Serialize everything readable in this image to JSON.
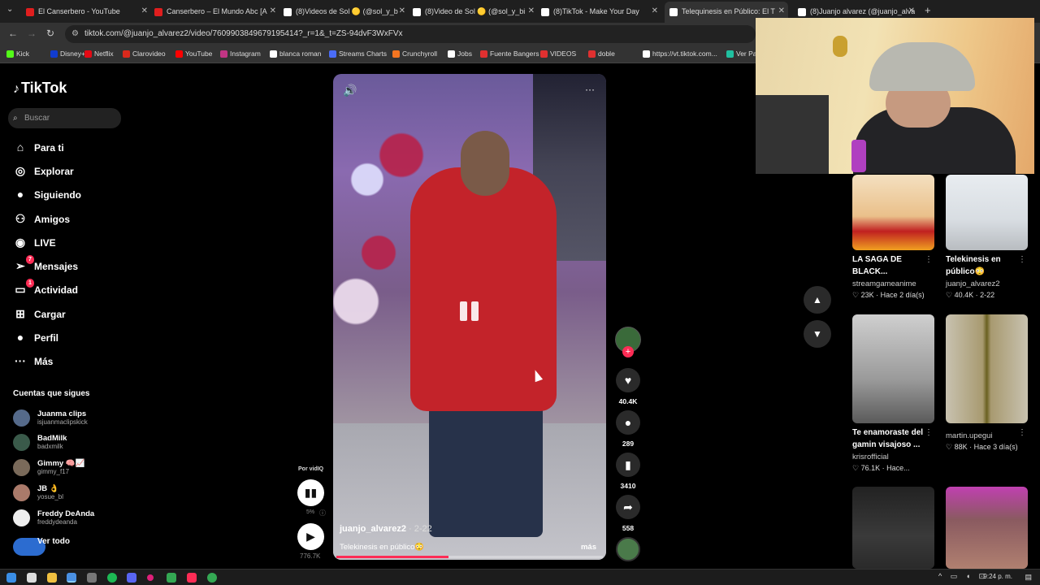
{
  "browser": {
    "tabs": [
      {
        "title": "El Canserbero - YouTube",
        "color": "#e01e1e"
      },
      {
        "title": "Canserbero – El Mundo Abc [A",
        "color": "#e01e1e"
      },
      {
        "title": "(8)Videos de Sol 🟡 (@sol_y_b",
        "color": "#ffffff"
      },
      {
        "title": "(8)Video de Sol 🟡 (@sol_y_bi",
        "color": "#ffffff"
      },
      {
        "title": "(8)TikTok - Make Your Day",
        "color": "#ffffff"
      },
      {
        "title": "Telequinesis en Público: El T",
        "color": "#ffffff"
      },
      {
        "title": "(8)Juanjo alvarez (@juanjo_alva",
        "color": "#ffffff"
      }
    ],
    "new_tab": "+",
    "url": "tiktok.com/@juanjo_alvarez2/video/7609903849679195414?_r=1&_t=ZS-94dvF3WxFVx",
    "bookmarks": [
      {
        "label": "Kick",
        "color": "#53fc18"
      },
      {
        "label": "Disney+",
        "color": "#113ccf"
      },
      {
        "label": "Netflix",
        "color": "#e50914"
      },
      {
        "label": "Clarovideo",
        "color": "#da291c"
      },
      {
        "label": "YouTube",
        "color": "#ff0000"
      },
      {
        "label": "Instagram",
        "color": "#c13584"
      },
      {
        "label": "blanca roman",
        "color": "#ffffff"
      },
      {
        "label": "Streams Charts",
        "color": "#4a6cf7"
      },
      {
        "label": "Crunchyroll",
        "color": "#f47521"
      },
      {
        "label": "Jobs",
        "color": "#ffffff"
      },
      {
        "label": "Fuente Bangers",
        "color": "#e03030"
      },
      {
        "label": "VIDEOS",
        "color": "#e03030"
      },
      {
        "label": "doble",
        "color": "#e03030"
      },
      {
        "label": "https://vt.tiktok.com...",
        "color": "#ffffff"
      },
      {
        "label": "Ver Pa",
        "color": "#20c0a0"
      }
    ]
  },
  "sidebar": {
    "logo": "TikTok",
    "search_placeholder": "Buscar",
    "nav": [
      {
        "label": "Para ti",
        "icon": "home-icon",
        "glyph": "⌂"
      },
      {
        "label": "Explorar",
        "icon": "compass-icon",
        "glyph": "◎"
      },
      {
        "label": "Siguiendo",
        "icon": "following-avatar-icon",
        "glyph": "●"
      },
      {
        "label": "Amigos",
        "icon": "friends-icon",
        "glyph": "⚇"
      },
      {
        "label": "LIVE",
        "icon": "live-icon",
        "glyph": "◉"
      },
      {
        "label": "Mensajes",
        "icon": "messages-icon",
        "glyph": "➢",
        "badge": "7"
      },
      {
        "label": "Actividad",
        "icon": "activity-icon",
        "glyph": "▭",
        "badge": "1"
      },
      {
        "label": "Cargar",
        "icon": "upload-icon",
        "glyph": "⊞"
      },
      {
        "label": "Perfil",
        "icon": "profile-icon",
        "glyph": "●"
      },
      {
        "label": "Más",
        "icon": "more-icon",
        "glyph": "···"
      }
    ],
    "following_title": "Cuentas que sigues",
    "accounts": [
      {
        "name": "Juanma clips",
        "handle": "isjuanmaclipskick"
      },
      {
        "name": "BadMilk",
        "handle": "badxmilk"
      },
      {
        "name": "Gimmy 🧠📈",
        "handle": "gimmy_f17"
      },
      {
        "name": "JB 👌",
        "handle": "yosue_bl"
      },
      {
        "name": "Freddy DeAnda",
        "handle": "freddydeanda"
      }
    ],
    "see_all": "Ver todo"
  },
  "video": {
    "author": "juanjo_alvarez2",
    "date": "· 2-22",
    "caption": "Telekinesis en público😳",
    "more": "más",
    "progress": 0.42
  },
  "actions": {
    "likes": "40.4K",
    "comments": "289",
    "saves": "3410",
    "shares": "558"
  },
  "vidiq": {
    "label": "Por vidIQ",
    "pct": "5%",
    "views": "776.7K"
  },
  "cards": [
    {
      "title": "LA SAGA DE BLACK...",
      "author": "streamgameanime",
      "stats": "♡ 23K · Hace 2 día(s)"
    },
    {
      "title": "Telekinesis en público😳",
      "author": "juanjo_alvarez2",
      "stats": "♡ 40.4K · 2-22"
    },
    {
      "title": "Te enamoraste del gamin visajoso ...",
      "author": "krisrofficial",
      "stats": "♡ 76.1K · Hace..."
    },
    {
      "title": "",
      "author": "martin.upegui",
      "stats": "♡ 88K · Hace 3 día(s)"
    }
  ],
  "taskbar": {
    "time": "9:24 p. m."
  }
}
